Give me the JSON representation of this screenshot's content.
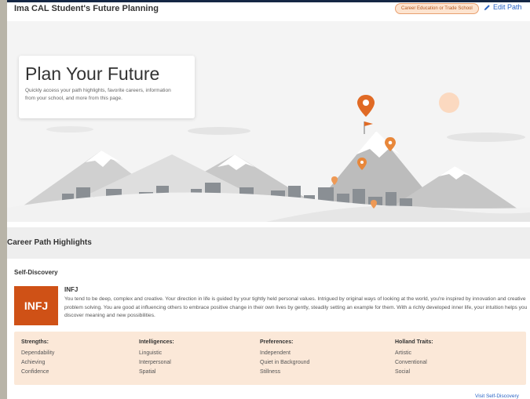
{
  "header": {
    "title": "Ima CAL Student's Future Planning",
    "badge": "Career Education or Trade School",
    "edit_label": "Edit Path"
  },
  "hero": {
    "heading": "Plan Your Future",
    "description": "Quickly access your path highlights, favorite careers, information from your school, and more from this page."
  },
  "highlights": {
    "heading": "Career Path Highlights",
    "self_discovery": {
      "label": "Self-Discovery",
      "type_code": "INFJ",
      "type_title": "INFJ",
      "description": "You tend to be deep, complex and creative. Your direction in life is guided by your tightly held personal values. Intrigued by original ways of looking at the world, you're inspired by innovation and creative problem solving. You are good at influencing others to embrace positive change in their own lives by gently, steadily setting an example for them. With a richly developed inner life, your intuition helps you discover meaning and new possibilities.",
      "traits": [
        {
          "heading": "Strengths:",
          "items": [
            "Dependability",
            "Achieving",
            "Confidence"
          ]
        },
        {
          "heading": "Intelligences:",
          "items": [
            "Linguistic",
            "Interpersonal",
            "Spatial"
          ]
        },
        {
          "heading": "Preferences:",
          "items": [
            "Independent",
            "Quiet in Background",
            "Stillness"
          ]
        },
        {
          "heading": "Holland Traits:",
          "items": [
            "Artistic",
            "Conventional",
            "Social"
          ]
        }
      ],
      "link": "Visit Self-Discovery"
    }
  },
  "colors": {
    "accent": "#cf5116",
    "link": "#2a64c5",
    "badge_bg": "#fde4d0",
    "traits_bg": "#fbe8d8"
  },
  "icons": [
    "pencil-icon",
    "map-pin-icon",
    "flag-icon",
    "sun-icon"
  ]
}
